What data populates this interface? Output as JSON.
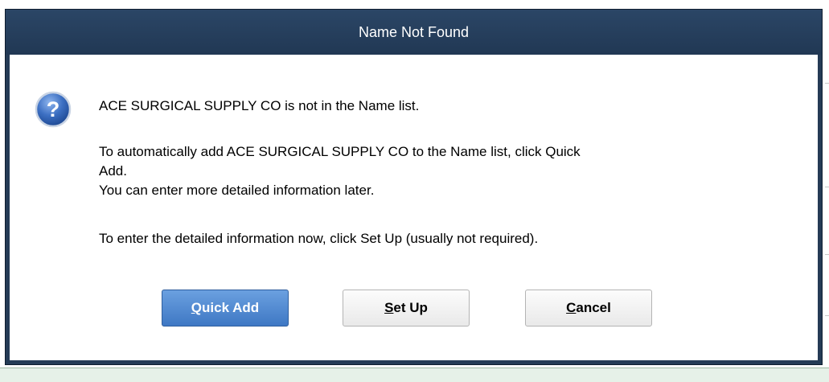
{
  "dialog": {
    "title": "Name Not Found",
    "icon": "question-icon",
    "message_1": "ACE SURGICAL SUPPLY CO is not in the Name list.",
    "message_2a": "To automatically add ACE SURGICAL SUPPLY CO to the Name list, click Quick",
    "message_2b": "Add.",
    "message_3": "You can enter more detailed information later.",
    "message_4": "To enter the detailed information now, click Set Up (usually not required).",
    "buttons": {
      "quick_add": {
        "mnemonic": "Q",
        "rest": "uick Add"
      },
      "set_up": {
        "mnemonic": "S",
        "rest": "et Up"
      },
      "cancel": {
        "mnemonic": "C",
        "rest": "ancel"
      }
    }
  },
  "colors": {
    "titlebar": "#253b56",
    "primary_button": "#4f87d2",
    "background_bottom": "#e6f1e8"
  }
}
